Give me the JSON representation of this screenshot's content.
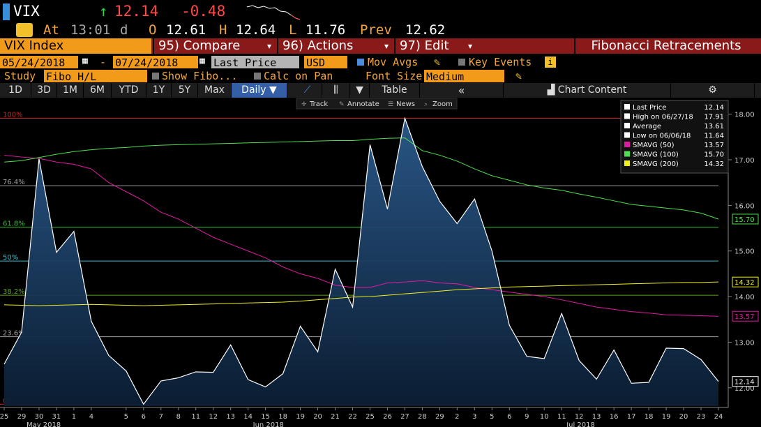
{
  "header": {
    "ticker": "VIX",
    "arrow": "↑",
    "last": "12.14",
    "change": "-0.48",
    "at_label": "At",
    "time": "13:01",
    "time_suffix": "d",
    "open_label": "O",
    "open": "12.61",
    "high_label": "H",
    "high": "12.64",
    "low_label": "L",
    "low": "11.76",
    "prev_label": "Prev",
    "prev": "12.62"
  },
  "toolbar": {
    "security": "VIX Index",
    "compare": "95) Compare",
    "actions": "96) Actions",
    "edit": "97) Edit",
    "study_title": "Fibonacci Retracements",
    "start_date": "05/24/2018",
    "dash": "-",
    "end_date": "07/24/2018",
    "price_field": "Last Price",
    "currency": "USD",
    "mov_avgs": "Mov Avgs",
    "key_events": "Key Events",
    "study_label": "Study",
    "study_value": "Fibo H/L",
    "show_fibo": "Show Fibo...",
    "calc_on_pan": "Calc on Pan",
    "font_size_label": "Font Size",
    "font_size_value": "Medium"
  },
  "periods": [
    "1D",
    "3D",
    "1M",
    "6M",
    "YTD",
    "1Y",
    "5Y",
    "Max",
    "Daily ▼"
  ],
  "period_extra": {
    "table": "Table",
    "collapse": "«",
    "chart_content": "Chart Content"
  },
  "chart_tools": [
    "Track",
    "Annotate",
    "News",
    "Zoom"
  ],
  "legend": [
    {
      "label": "Last Price",
      "value": "12.14",
      "color": "#ffffff"
    },
    {
      "label": "High on 06/27/18",
      "value": "17.91",
      "color": "#ffffff"
    },
    {
      "label": "Average",
      "value": "13.61",
      "color": "#ffffff"
    },
    {
      "label": "Low on 06/06/18",
      "value": "11.64",
      "color": "#ffffff"
    },
    {
      "label": "SMAVG (50)",
      "value": "13.57",
      "color": "#e01aa0"
    },
    {
      "label": "SMAVG (100)",
      "value": "15.70",
      "color": "#4de04d"
    },
    {
      "label": "SMAVG (200)",
      "value": "14.32",
      "color": "#f0f020"
    }
  ],
  "chart_data": {
    "type": "area",
    "x": [
      "25",
      "29",
      "30",
      "31",
      "1",
      "4",
      "5",
      "6",
      "7",
      "8",
      "11",
      "12",
      "13",
      "14",
      "15",
      "18",
      "19",
      "20",
      "21",
      "22",
      "25",
      "26",
      "27",
      "28",
      "29",
      "2",
      "3",
      "5",
      "6",
      "9",
      "10",
      "11",
      "12",
      "13",
      "16",
      "17",
      "18",
      "19",
      "20",
      "23",
      "24"
    ],
    "month_labels": [
      "May 2018",
      "Jun 2018",
      "Jul 2018"
    ],
    "ylim": [
      11.6,
      18.3
    ],
    "yticks": [
      "12.00",
      "13.00",
      "14.00",
      "15.00",
      "16.00",
      "17.00",
      "18.00"
    ],
    "series": [
      {
        "name": "Last Price",
        "color": "#ffffff",
        "values": [
          12.52,
          13.22,
          17.02,
          14.97,
          15.43,
          13.46,
          12.71,
          12.37,
          11.64,
          12.15,
          12.22,
          12.35,
          12.34,
          12.94,
          12.18,
          12.02,
          12.31,
          13.35,
          12.79,
          14.6,
          13.77,
          17.33,
          15.92,
          17.91,
          16.85,
          16.09,
          15.6,
          16.14,
          15.0,
          13.37,
          12.69,
          12.64,
          13.63,
          12.6,
          12.19,
          12.83,
          12.1,
          12.12,
          12.87,
          12.86,
          12.62,
          12.14
        ]
      },
      {
        "name": "SMAVG (50)",
        "color": "#e01aa0",
        "values": [
          17.1,
          17.06,
          17.03,
          16.95,
          16.9,
          16.8,
          16.5,
          16.3,
          16.1,
          15.85,
          15.7,
          15.5,
          15.3,
          15.15,
          15.0,
          14.85,
          14.65,
          14.5,
          14.4,
          14.25,
          14.2,
          14.2,
          14.3,
          14.32,
          14.35,
          14.3,
          14.28,
          14.2,
          14.15,
          14.1,
          14.05,
          14.0,
          13.93,
          13.85,
          13.77,
          13.72,
          13.67,
          13.64,
          13.6,
          13.59,
          13.58,
          13.57
        ]
      },
      {
        "name": "SMAVG (100)",
        "color": "#4de04d",
        "values": [
          16.95,
          16.98,
          17.05,
          17.12,
          17.18,
          17.22,
          17.25,
          17.27,
          17.3,
          17.32,
          17.33,
          17.34,
          17.35,
          17.36,
          17.37,
          17.38,
          17.39,
          17.4,
          17.41,
          17.42,
          17.42,
          17.45,
          17.47,
          17.48,
          17.2,
          17.1,
          16.97,
          16.8,
          16.65,
          16.55,
          16.45,
          16.38,
          16.33,
          16.25,
          16.18,
          16.1,
          16.02,
          15.98,
          15.94,
          15.9,
          15.83,
          15.7
        ]
      },
      {
        "name": "SMAVG (200)",
        "color": "#f0f020",
        "values": [
          13.82,
          13.81,
          13.8,
          13.81,
          13.82,
          13.83,
          13.82,
          13.81,
          13.8,
          13.81,
          13.82,
          13.83,
          13.84,
          13.85,
          13.86,
          13.87,
          13.88,
          13.9,
          13.93,
          13.96,
          13.99,
          14.0,
          14.03,
          14.06,
          14.09,
          14.12,
          14.15,
          14.17,
          14.19,
          14.21,
          14.22,
          14.23,
          14.24,
          14.25,
          14.26,
          14.27,
          14.28,
          14.29,
          14.3,
          14.31,
          14.31,
          14.32
        ]
      }
    ],
    "fibonacci": [
      {
        "label": "100%",
        "value": 17.91,
        "color": "#d02020"
      },
      {
        "label": "76.4%",
        "value": 16.43,
        "color": "#a0a0a0"
      },
      {
        "label": "61.8%",
        "value": 15.52,
        "color": "#30c030"
      },
      {
        "label": "50%",
        "value": 14.78,
        "color": "#30c0d0"
      },
      {
        "label": "38.2%",
        "value": 14.03,
        "color": "#60a020"
      },
      {
        "label": "23.6%",
        "value": 13.12,
        "color": "#a0a0a0"
      },
      {
        "label": "0%",
        "value": 11.64,
        "color": "#d02020"
      }
    ],
    "right_labels": [
      {
        "value": "15.70",
        "color": "#4de04d"
      },
      {
        "value": "14.32",
        "color": "#f0f020"
      },
      {
        "value": "13.57",
        "color": "#e01aa0"
      },
      {
        "value": "12.14",
        "color": "#ffffff"
      }
    ]
  }
}
